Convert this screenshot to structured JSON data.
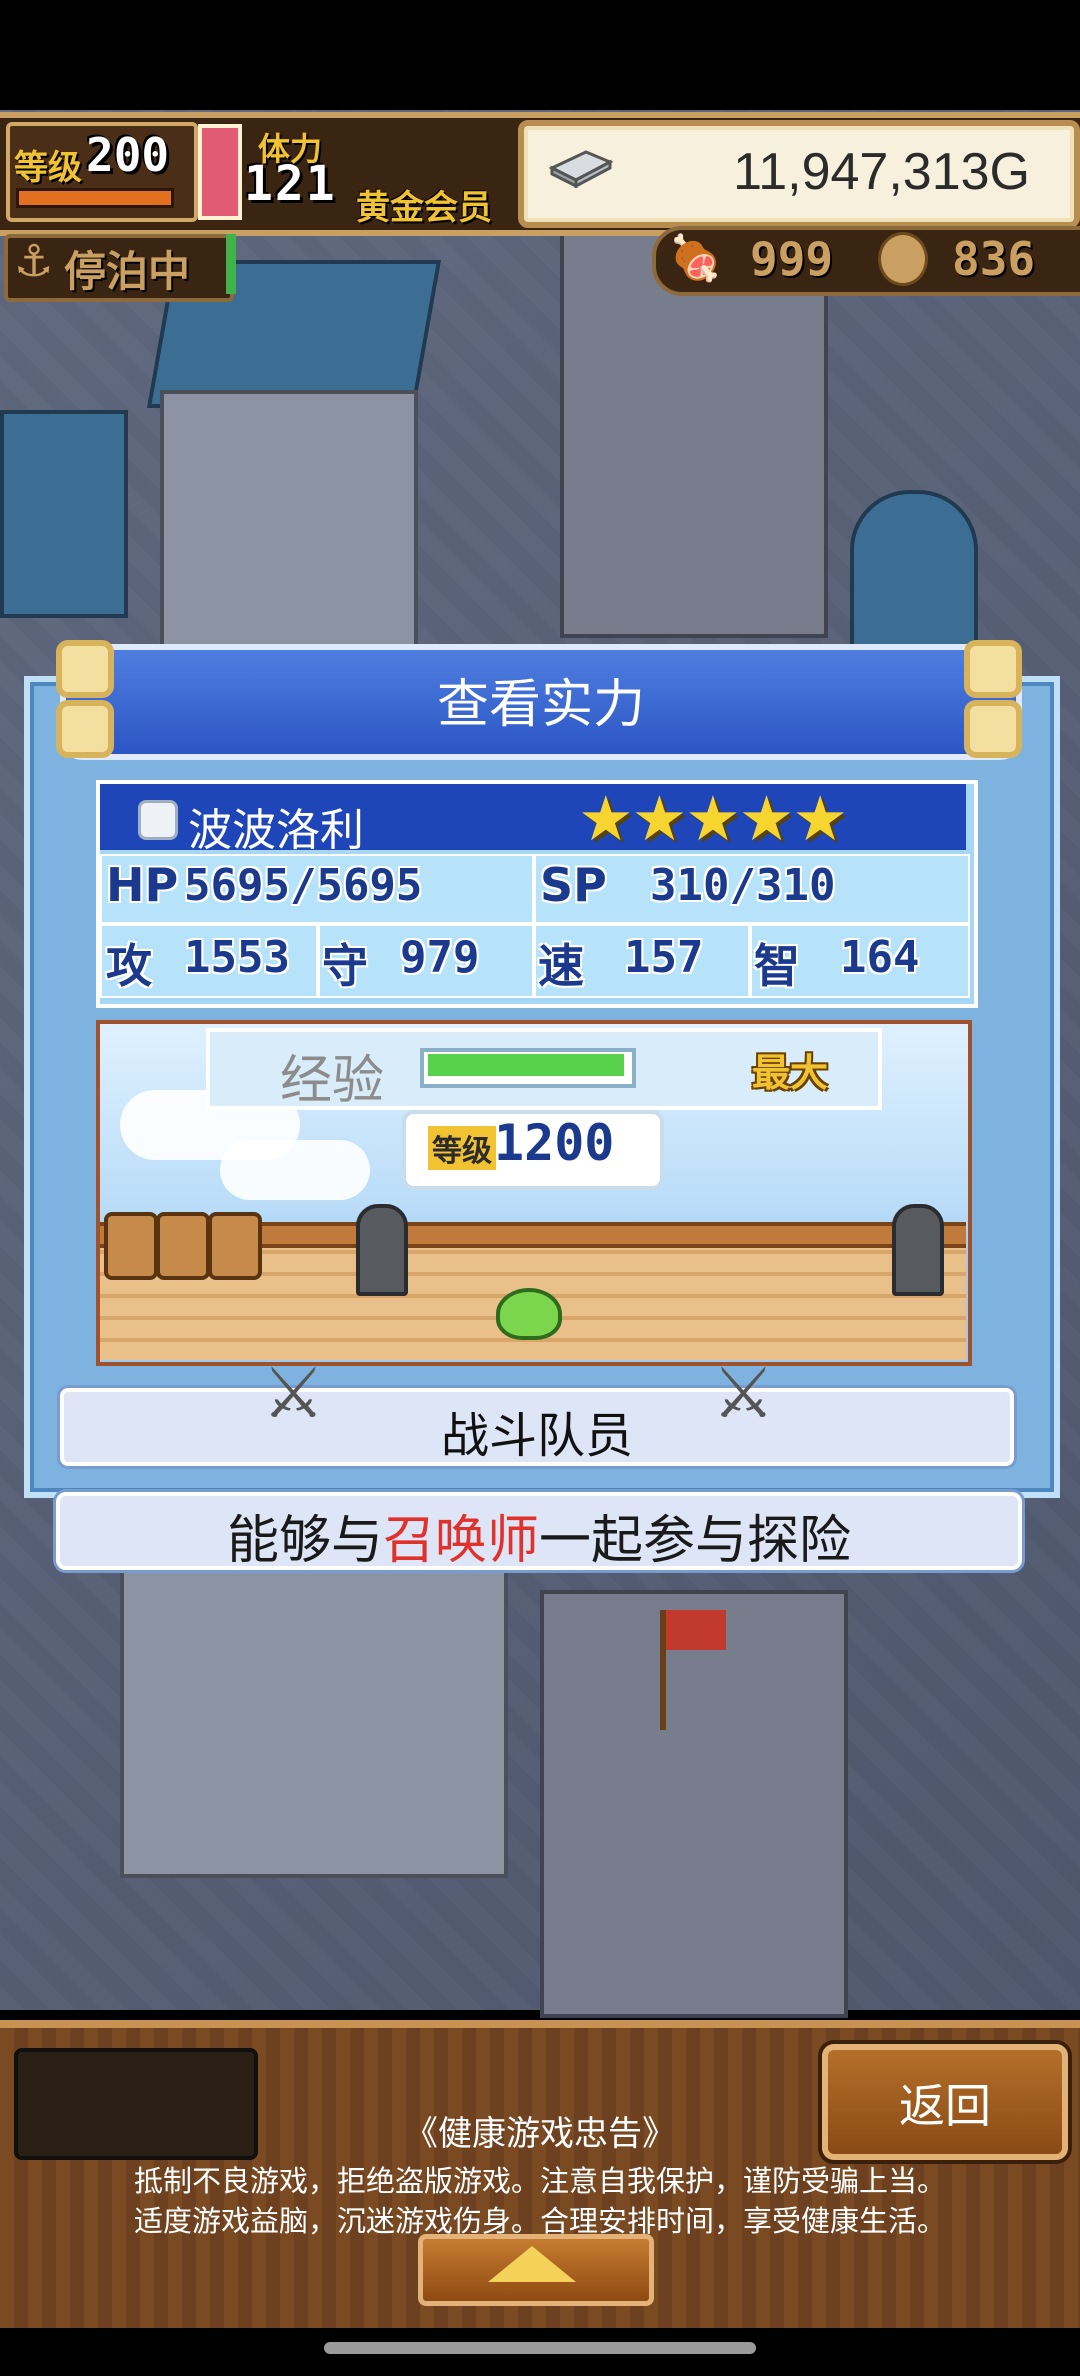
{
  "hud": {
    "level_label": "等级",
    "level_value": "200",
    "stamina_label": "体力",
    "stamina_value": "121",
    "vip_label": "黄金会员",
    "gold_value": "11,947,313G",
    "moored_label": "停泊中",
    "resource_1_value": "999",
    "resource_2_value": "836"
  },
  "dialog": {
    "title": "查看实力",
    "character": {
      "name": "波波洛利",
      "stars": "★★★★★",
      "hp_label": "HP",
      "hp_value": "5695/5695",
      "sp_label": "SP",
      "sp_value": "310/310",
      "atk_label": "攻",
      "atk_value": "1553",
      "def_label": "守",
      "def_value": "979",
      "spd_label": "速",
      "spd_value": "157",
      "int_label": "智",
      "int_value": "164"
    },
    "exp_label": "经验",
    "exp_fill_percent": 100,
    "exp_max_label": "最大",
    "level_label": "等级",
    "level_value": "1200",
    "member_label": "战斗队员",
    "desc_before": "能够与",
    "desc_highlight": "召唤师",
    "desc_after": "一起参与探险"
  },
  "bottom": {
    "back_label": "返回",
    "notice_title": "《健康游戏忠告》",
    "notice_line_1": "抵制不良游戏，拒绝盗版游戏。注意自我保护，谨防受骗上当。",
    "notice_line_2": "适度游戏益脑，沉迷游戏伤身。合理安排时间，享受健康生活。"
  },
  "colors": {
    "panel_blue": "#7eb3e0",
    "title_blue": "#2c56c4",
    "highlight_red": "#e0312b",
    "gold": "#f1c232"
  }
}
